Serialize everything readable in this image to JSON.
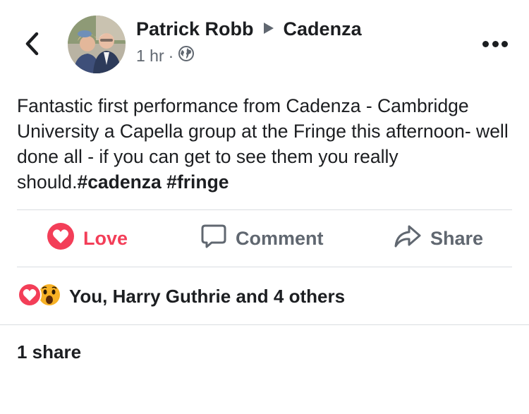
{
  "post": {
    "author": "Patrick Robb",
    "target": "Cadenza",
    "time": "1 hr",
    "separator": "·",
    "text": "Fantastic first performance from Cadenza - Cambridge University a Capella group at the Fringe this afternoon- well done all - if you can get to see them you really should.",
    "hashtags": [
      "#cadenza",
      "#fringe"
    ]
  },
  "actions": {
    "love": "Love",
    "comment": "Comment",
    "share": "Share"
  },
  "reactions": {
    "summary": "You, Harry Guthrie and 4 others",
    "icons": [
      "love-reaction-icon",
      "wow-reaction-icon"
    ]
  },
  "shares": {
    "count_label": "1 share"
  },
  "colors": {
    "love": "#f33e58",
    "text": "#1c1e21",
    "secondary": "#606770",
    "divider": "#dadde1"
  }
}
